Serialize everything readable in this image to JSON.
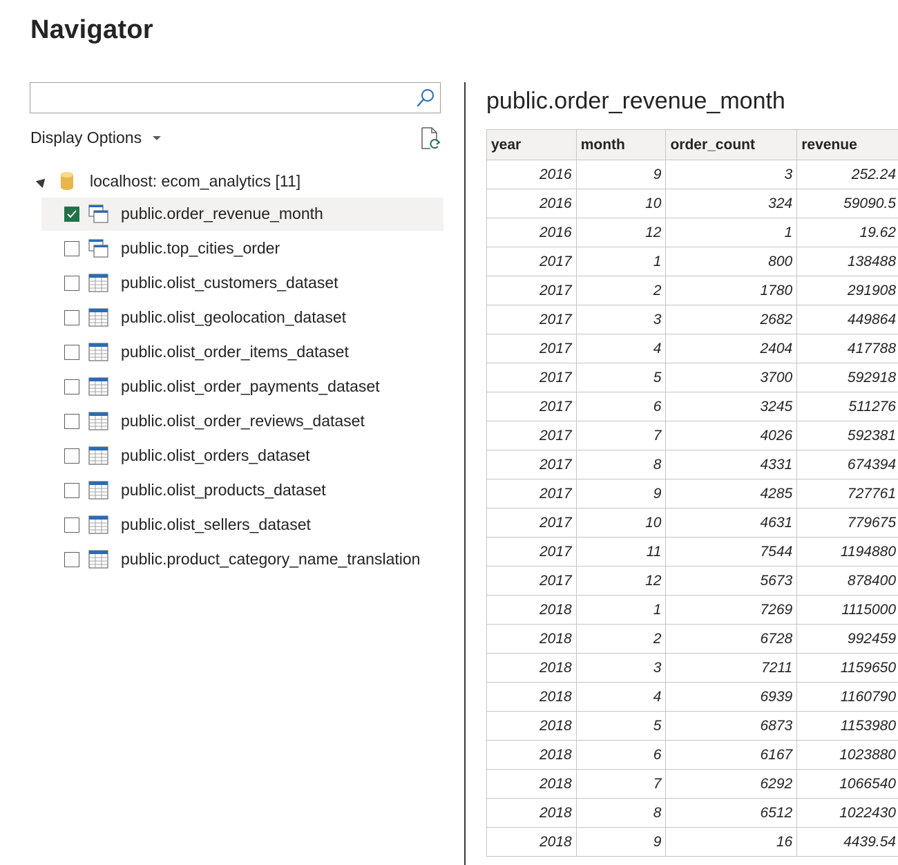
{
  "header": {
    "title": "Navigator"
  },
  "search": {
    "value": "",
    "placeholder": ""
  },
  "display_options": {
    "label": "Display Options"
  },
  "tree": {
    "root_label": "localhost: ecom_analytics [11]",
    "items": [
      {
        "label": "public.order_revenue_month",
        "checked": true,
        "selected": true,
        "icon": "view-icon"
      },
      {
        "label": "public.top_cities_order",
        "checked": false,
        "selected": false,
        "icon": "view-icon"
      },
      {
        "label": "public.olist_customers_dataset",
        "checked": false,
        "selected": false,
        "icon": "table-icon"
      },
      {
        "label": "public.olist_geolocation_dataset",
        "checked": false,
        "selected": false,
        "icon": "table-icon"
      },
      {
        "label": "public.olist_order_items_dataset",
        "checked": false,
        "selected": false,
        "icon": "table-icon"
      },
      {
        "label": "public.olist_order_payments_dataset",
        "checked": false,
        "selected": false,
        "icon": "table-icon"
      },
      {
        "label": "public.olist_order_reviews_dataset",
        "checked": false,
        "selected": false,
        "icon": "table-icon"
      },
      {
        "label": "public.olist_orders_dataset",
        "checked": false,
        "selected": false,
        "icon": "table-icon"
      },
      {
        "label": "public.olist_products_dataset",
        "checked": false,
        "selected": false,
        "icon": "table-icon"
      },
      {
        "label": "public.olist_sellers_dataset",
        "checked": false,
        "selected": false,
        "icon": "table-icon"
      },
      {
        "label": "public.product_category_name_translation",
        "checked": false,
        "selected": false,
        "icon": "table-icon"
      }
    ]
  },
  "preview": {
    "title": "public.order_revenue_month",
    "columns": [
      "year",
      "month",
      "order_count",
      "revenue"
    ],
    "rows": [
      [
        "2016",
        "9",
        "3",
        "252.24"
      ],
      [
        "2016",
        "10",
        "324",
        "59090.5"
      ],
      [
        "2016",
        "12",
        "1",
        "19.62"
      ],
      [
        "2017",
        "1",
        "800",
        "138488"
      ],
      [
        "2017",
        "2",
        "1780",
        "291908"
      ],
      [
        "2017",
        "3",
        "2682",
        "449864"
      ],
      [
        "2017",
        "4",
        "2404",
        "417788"
      ],
      [
        "2017",
        "5",
        "3700",
        "592918"
      ],
      [
        "2017",
        "6",
        "3245",
        "511276"
      ],
      [
        "2017",
        "7",
        "4026",
        "592381"
      ],
      [
        "2017",
        "8",
        "4331",
        "674394"
      ],
      [
        "2017",
        "9",
        "4285",
        "727761"
      ],
      [
        "2017",
        "10",
        "4631",
        "779675"
      ],
      [
        "2017",
        "11",
        "7544",
        "1194880"
      ],
      [
        "2017",
        "12",
        "5673",
        "878400"
      ],
      [
        "2018",
        "1",
        "7269",
        "1115000"
      ],
      [
        "2018",
        "2",
        "6728",
        "992459"
      ],
      [
        "2018",
        "3",
        "7211",
        "1159650"
      ],
      [
        "2018",
        "4",
        "6939",
        "1160790"
      ],
      [
        "2018",
        "5",
        "6873",
        "1153980"
      ],
      [
        "2018",
        "6",
        "6167",
        "1023880"
      ],
      [
        "2018",
        "7",
        "6292",
        "1066540"
      ],
      [
        "2018",
        "8",
        "6512",
        "1022430"
      ],
      [
        "2018",
        "9",
        "16",
        "4439.54"
      ]
    ]
  },
  "colors": {
    "accent": "#217346",
    "selected_bg": "#f3f2f1",
    "icon_blue": "#2b6cb0"
  }
}
